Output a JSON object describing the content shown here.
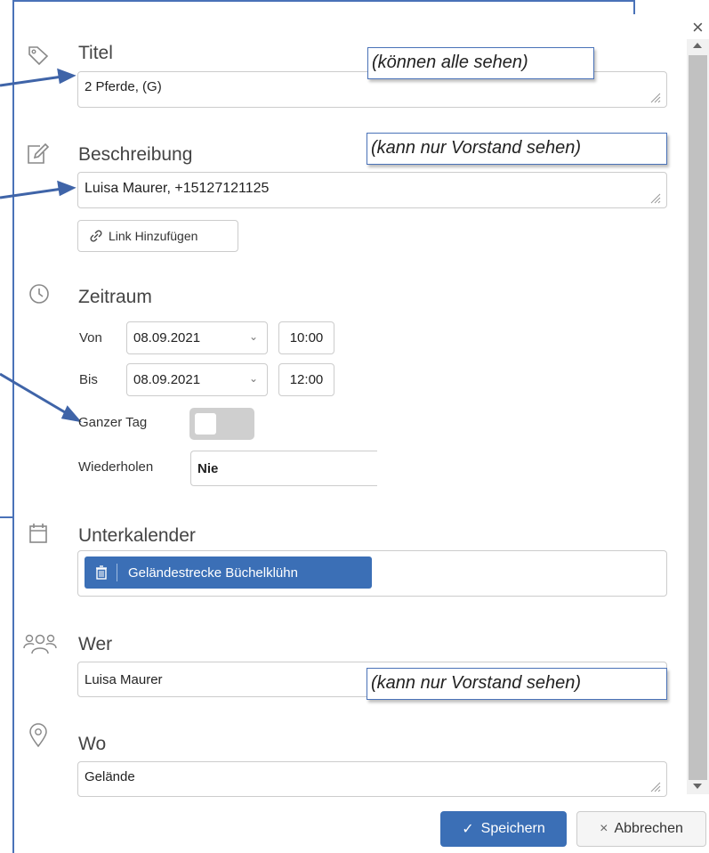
{
  "dialog": {
    "close_glyph": "×",
    "title": {
      "label": "Titel",
      "value": "2 Pferde, (G)",
      "icon": "tag-icon"
    },
    "description": {
      "label": "Beschreibung",
      "value": "Luisa Maurer, +15127121125",
      "icon": "edit-icon",
      "link_button": "Link Hinzufügen"
    },
    "timerange": {
      "label": "Zeitraum",
      "icon": "clock-icon",
      "from_label": "Von",
      "from_date": "08.09.2021",
      "from_time": "10:00",
      "to_label": "Bis",
      "to_date": "08.09.2021",
      "to_time": "12:00",
      "allday_label": "Ganzer Tag",
      "allday_on": false,
      "repeat_label": "Wiederholen",
      "repeat_value": "Nie"
    },
    "subcalendar": {
      "label": "Unterkalender",
      "icon": "calendar-icon",
      "tag": "Geländestrecke Büchelklühn"
    },
    "who": {
      "label": "Wer",
      "value": "Luisa Maurer",
      "icon": "people-icon"
    },
    "where": {
      "label": "Wo",
      "value": "Gelände",
      "icon": "location-icon"
    },
    "buttons": {
      "save": "Speichern",
      "cancel": "Abbrechen"
    }
  },
  "annotations": {
    "note1": "(können alle sehen)",
    "note2": "(kann nur Vorstand sehen)",
    "note3": "(kann nur Vorstand sehen)"
  },
  "colors": {
    "accent": "#3b6fb6",
    "frame": "#4a72b8"
  }
}
